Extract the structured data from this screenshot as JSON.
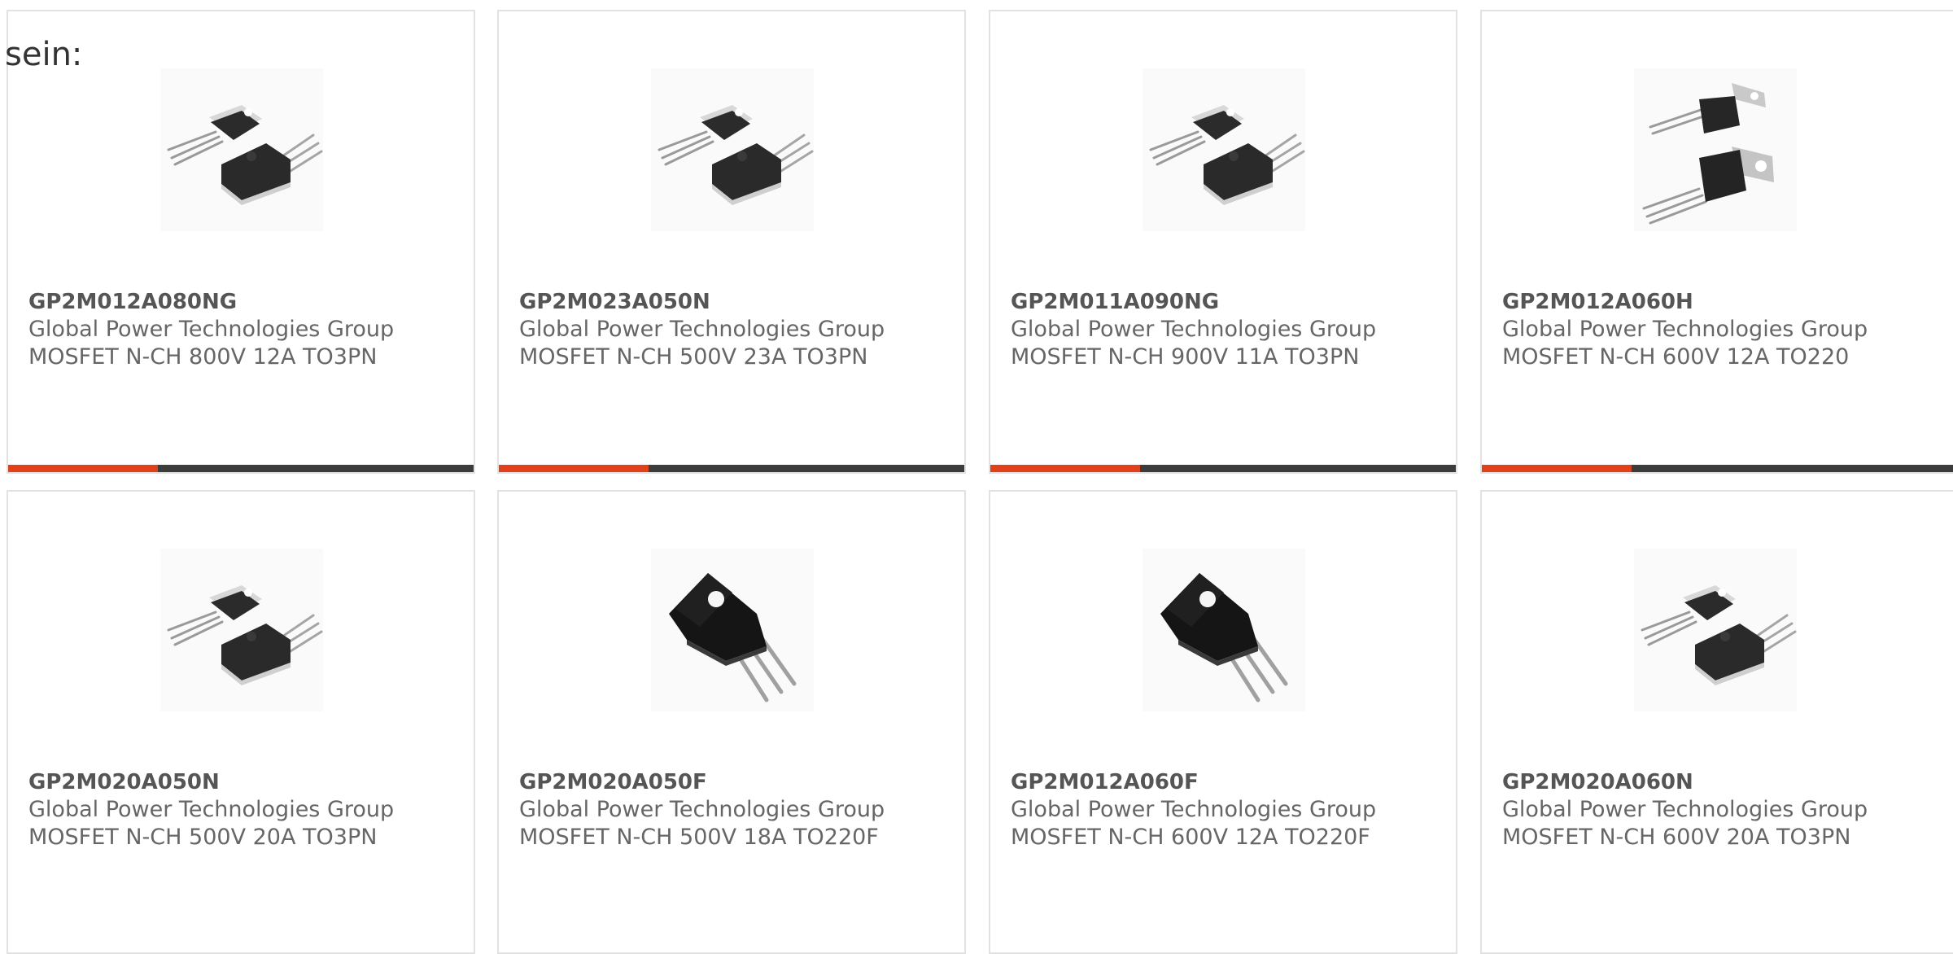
{
  "intro_text": "sein:",
  "colors": {
    "accent": "#e2401a",
    "bar": "#3c3c3c",
    "border": "#e2e2e2"
  },
  "products": [
    {
      "name": "GP2M012A080NG",
      "maker": "Global Power Technologies Group",
      "desc": "MOSFET N-CH 800V 12A TO3PN",
      "icon": "to3pn-package-image"
    },
    {
      "name": "GP2M023A050N",
      "maker": "Global Power Technologies Group",
      "desc": "MOSFET N-CH 500V 23A TO3PN",
      "icon": "to3pn-package-image"
    },
    {
      "name": "GP2M011A090NG",
      "maker": "Global Power Technologies Group",
      "desc": "MOSFET N-CH 900V 11A TO3PN",
      "icon": "to3pn-package-image"
    },
    {
      "name": "GP2M012A060H",
      "maker": "Global Power Technologies Group",
      "desc": "MOSFET N-CH 600V 12A TO220",
      "icon": "to220-package-image"
    },
    {
      "name": "GP2M020A050N",
      "maker": "Global Power Technologies Group",
      "desc": "MOSFET N-CH 500V 20A TO3PN",
      "icon": "to3pn-package-image"
    },
    {
      "name": "GP2M020A050F",
      "maker": "Global Power Technologies Group",
      "desc": "MOSFET N-CH 500V 18A TO220F",
      "icon": "to220f-package-image"
    },
    {
      "name": "GP2M012A060F",
      "maker": "Global Power Technologies Group",
      "desc": "MOSFET N-CH 600V 12A TO220F",
      "icon": "to220f-package-image"
    },
    {
      "name": "GP2M020A060N",
      "maker": "Global Power Technologies Group",
      "desc": "MOSFET N-CH 600V 20A TO3PN",
      "icon": "to3pn-package-image"
    }
  ]
}
